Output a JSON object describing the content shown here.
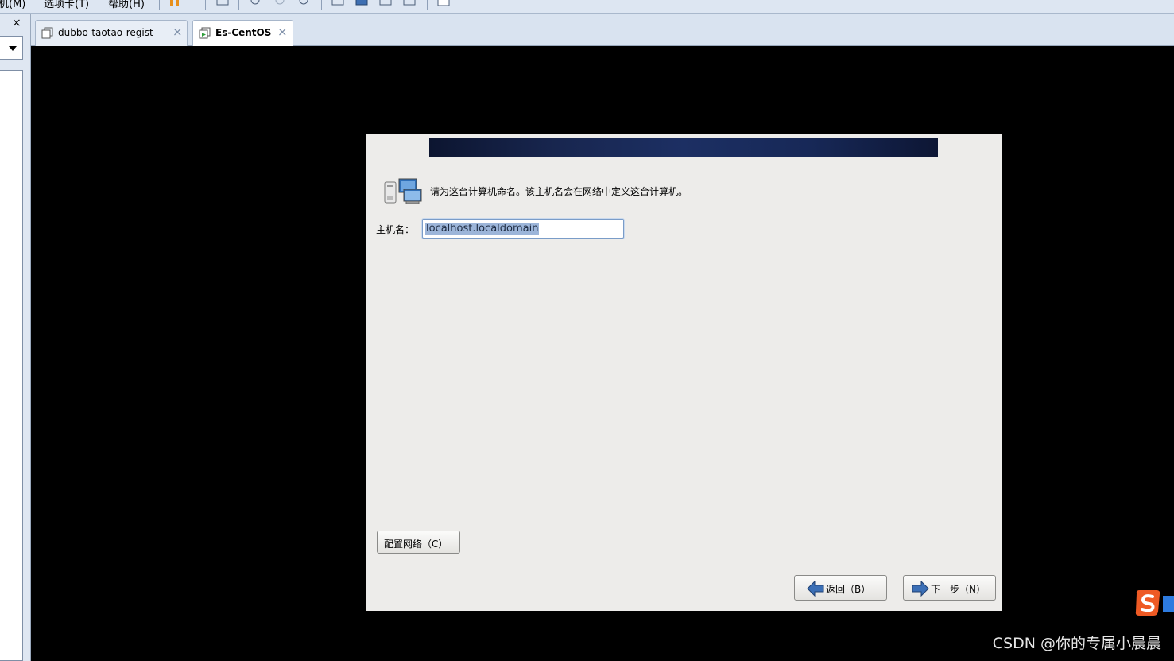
{
  "menubar": {
    "items": [
      "机(M)",
      "选项卡(T)",
      "帮助(H)"
    ]
  },
  "left_panel": {
    "close_label": "×"
  },
  "tabs": [
    {
      "label": "dubbo-taotao-regist",
      "close": "×",
      "active": false
    },
    {
      "label": "Es-CentOS",
      "close": "×",
      "active": true
    }
  ],
  "installer": {
    "prompt": "请为这台计算机命名。该主机名会在网络中定义这台计算机。",
    "hostname_label": "主机名：",
    "hostname_value": "localhost.localdomain",
    "configure_network_button": "配置网络（C）",
    "back_button": "返回（B）",
    "next_button": "下一步（N）"
  },
  "overlay": {
    "watermark": "CSDN @你的专属小晨晨"
  },
  "colors": {
    "vm_background": "#000000",
    "installer_background": "#edecea",
    "banner": "#1c2f63",
    "selection": "#9cb5d9"
  }
}
